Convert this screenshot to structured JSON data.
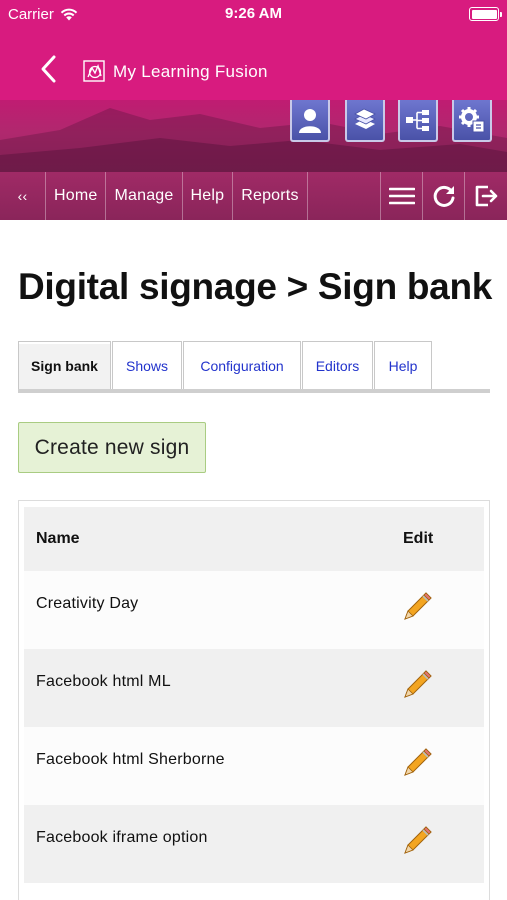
{
  "status_bar": {
    "carrier": "Carrier",
    "time": "9:26 AM"
  },
  "header": {
    "title": "My Learning Fusion"
  },
  "toolbar_icons": [
    "user-icon",
    "books-icon",
    "sitemap-icon",
    "settings-icon"
  ],
  "nav": {
    "collapse_label": "‹‹",
    "items": [
      {
        "label": "Home"
      },
      {
        "label": "Manage"
      },
      {
        "label": "Help"
      },
      {
        "label": "Reports"
      }
    ],
    "right_icons": [
      "menu-icon",
      "refresh-icon",
      "logout-icon"
    ]
  },
  "page": {
    "title": "Digital signage > Sign bank",
    "tabs": [
      {
        "label": "Sign bank",
        "active": true
      },
      {
        "label": "Shows"
      },
      {
        "label": "Configuration"
      },
      {
        "label": "Editors"
      },
      {
        "label": "Help"
      }
    ],
    "create_button": "Create new sign"
  },
  "table": {
    "headers": {
      "name": "Name",
      "edit": "Edit"
    },
    "rows": [
      {
        "name": "Creativity Day"
      },
      {
        "name": "Facebook html ML"
      },
      {
        "name": "Facebook html Sherborne"
      },
      {
        "name": "Facebook iframe option"
      }
    ]
  },
  "colors": {
    "brand": "#d81b7f",
    "nav": "#8a255a",
    "icon_button": "#4a52a8",
    "link": "#2233cc",
    "create_button_bg": "#e6f2d6"
  }
}
